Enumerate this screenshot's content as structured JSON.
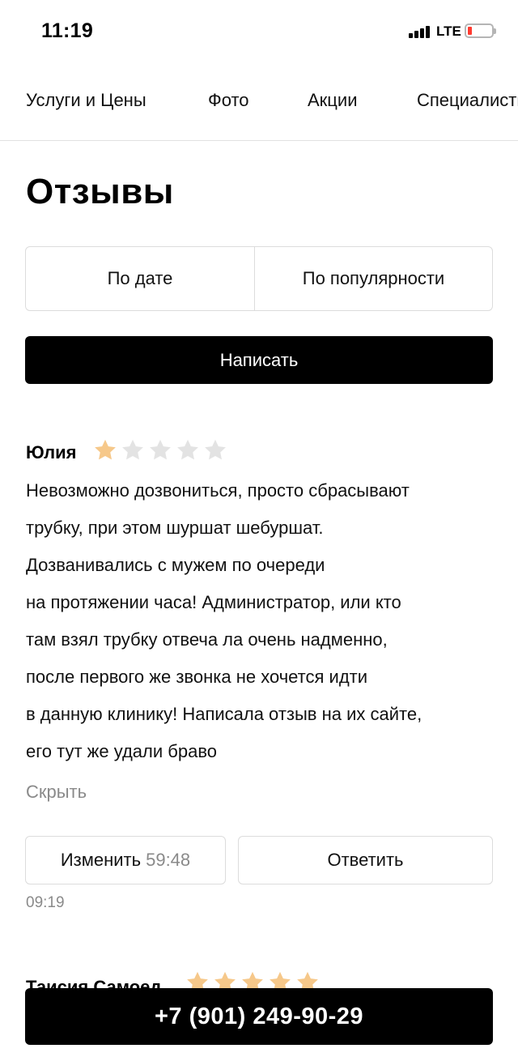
{
  "status_bar": {
    "time": "11:19",
    "network": "LTE",
    "battery_color": "#ff3b30"
  },
  "nav": {
    "tabs": [
      "Услуги и Цены",
      "Фото",
      "Акции",
      "Специалисты"
    ]
  },
  "page_title": "Отзывы",
  "sort": {
    "by_date": "По дате",
    "by_popularity": "По популярности"
  },
  "write_button": "Написать",
  "reviews": [
    {
      "author": "Юлия",
      "rating": 1,
      "max_rating": 5,
      "text_lines": [
        "Невозможно дозвониться, просто сбрасывают",
        "трубку, при этом шуршат шебуршат.",
        "Дозванивались с мужем по очереди",
        "на протяжении часа! Администратор, или кто",
        "там взял трубку отвеча ла очень надменно,",
        "после первого же звонка не хочется идти",
        "в данную клинику! Написала отзыв на их сайте,",
        "его тут же удали браво"
      ],
      "hide_label": "Скрыть",
      "edit_label": "Изменить",
      "edit_timer": "59:48",
      "reply_label": "Ответить",
      "time": "09:19"
    },
    {
      "author": "Таисия Самоед",
      "rating": 5,
      "max_rating": 5
    }
  ],
  "phone_button": "+7 (901) 249-90-29",
  "colors": {
    "star_filled": "#f6c88a",
    "star_empty": "#e3e3e3",
    "accent": "#000000",
    "muted": "#8a8a8a"
  }
}
